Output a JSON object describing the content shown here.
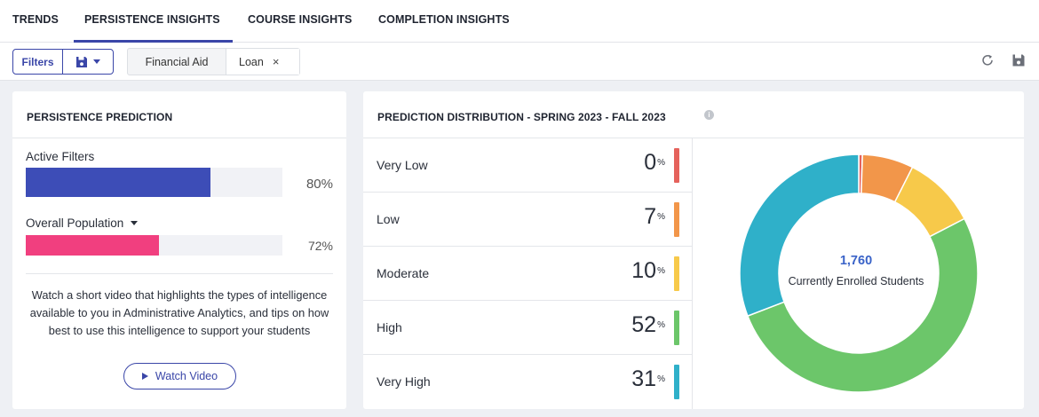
{
  "nav": {
    "tabs": [
      {
        "label": "TRENDS"
      },
      {
        "label": "PERSISTENCE INSIGHTS"
      },
      {
        "label": "COURSE INSIGHTS"
      },
      {
        "label": "COMPLETION INSIGHTS"
      }
    ],
    "active_tab": "PERSISTENCE INSIGHTS"
  },
  "filterbar": {
    "filters_label": "Filters",
    "save_icon": "floppy-disk-icon",
    "chips": [
      {
        "label": "Financial Aid"
      },
      {
        "label": "Loan"
      }
    ],
    "chip_remove": "×",
    "right_icons": [
      "refresh-icon",
      "save-icon"
    ]
  },
  "persistence": {
    "title": "PERSISTENCE PREDICTION",
    "active": {
      "label": "Active Filters",
      "value": 0.8,
      "display": "80%"
    },
    "overall": {
      "label": "Overall Population",
      "value": 0.72,
      "display": "72%"
    },
    "video_text": "Watch a short video that highlights the types of intelligence available to you in Administrative Analytics, and tips on how best to use this intelligence to support your students",
    "watch_label": "Watch Video"
  },
  "distribution": {
    "title": "PREDICTION DISTRIBUTION - SPRING 2023 - FALL 2023",
    "info_icon": "i",
    "rows": [
      {
        "label": "Very Low",
        "value": "0",
        "unit": "%",
        "color": "#e5625c"
      },
      {
        "label": "Low",
        "value": "7",
        "unit": "%",
        "color": "#f2964a"
      },
      {
        "label": "Moderate",
        "value": "10",
        "unit": "%",
        "color": "#f7c94a"
      },
      {
        "label": "High",
        "value": "52",
        "unit": "%",
        "color": "#6cc66a"
      },
      {
        "label": "Very High",
        "value": "31",
        "unit": "%",
        "color": "#2fb0c9"
      }
    ],
    "center_value": "1,760",
    "center_label": "Currently Enrolled Students"
  },
  "colors": {
    "accent": "#3a46a8",
    "active_bar": "#3d4db7",
    "overall_bar": "#f13f7f"
  },
  "chart_data": {
    "type": "pie",
    "categories": [
      "Very Low",
      "Low",
      "Moderate",
      "High",
      "Very High"
    ],
    "values": [
      0.5,
      7,
      10,
      52,
      31
    ],
    "colors": [
      "#e5625c",
      "#f2964a",
      "#f7c94a",
      "#6cc66a",
      "#2fb0c9"
    ]
  }
}
